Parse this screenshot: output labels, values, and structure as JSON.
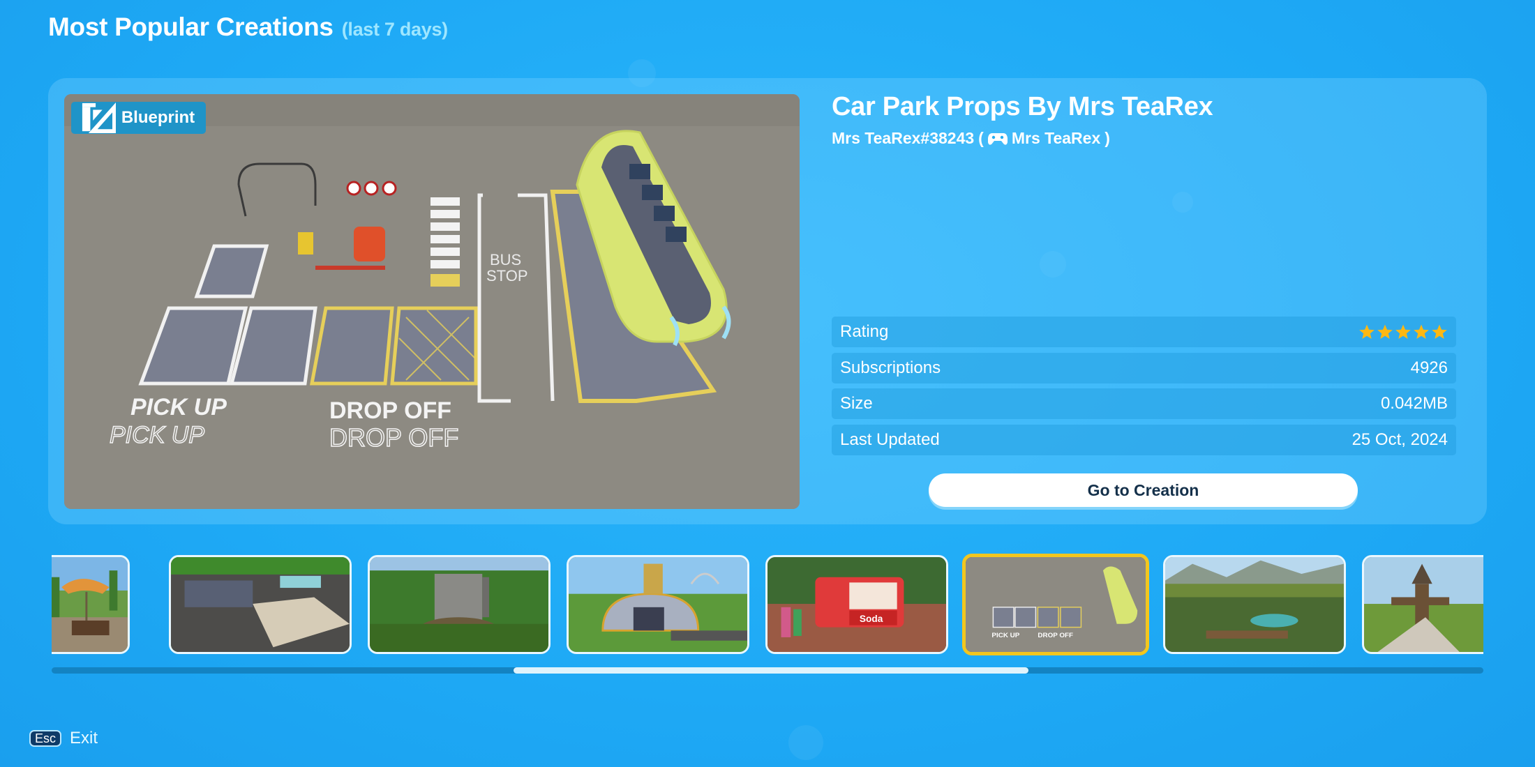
{
  "page": {
    "title": "Most Popular Creations",
    "subtitle": "(last 7 days)"
  },
  "featured": {
    "badge": {
      "icon": "blueprint-icon",
      "label": "Blueprint"
    },
    "image_alt": "Car park props: pick up / drop off markings, bus stop, speed signs, barrier, bus",
    "title": "Car Park Props By Mrs TeaRex",
    "creator_id": "Mrs TeaRex#38243",
    "creator_open": "(",
    "creator_icon": "gamepad-icon",
    "creator_name": "Mrs TeaRex",
    "creator_close": ")",
    "stats": [
      {
        "label": "Rating",
        "value": null,
        "rating": 5,
        "rating_max": 5
      },
      {
        "label": "Subscriptions",
        "value": "4926"
      },
      {
        "label": "Size",
        "value": "0.042MB"
      },
      {
        "label": "Last Updated",
        "value": "25 Oct, 2024"
      }
    ],
    "action_label": "Go to Creation"
  },
  "carousel": {
    "selected_index": 5,
    "items": [
      {
        "name": "thumb-picnic-area",
        "desc": "Picnic area with orange umbrella"
      },
      {
        "name": "thumb-parking-lot",
        "desc": "Large parking lot"
      },
      {
        "name": "thumb-castle-ride",
        "desc": "Castle with waterfall ride"
      },
      {
        "name": "thumb-coaster-station",
        "desc": "Coaster station building"
      },
      {
        "name": "thumb-soda-cart",
        "desc": "Red soda cart"
      },
      {
        "name": "thumb-car-park-props",
        "desc": "Car Park Props"
      },
      {
        "name": "thumb-mountain-park",
        "desc": "Mountain park overview"
      },
      {
        "name": "thumb-wooden-gate",
        "desc": "Wooden gate entrance"
      }
    ],
    "scroll_position": 0.36,
    "scroll_visible_fraction": 0.36
  },
  "footer": {
    "key_label": "Esc",
    "action_label": "Exit"
  },
  "colors": {
    "background": "#1ea9f5",
    "star": "#fdb813",
    "selected_border": "#f2c61f",
    "badge": "#1f94c8",
    "button_text": "#14304a"
  }
}
